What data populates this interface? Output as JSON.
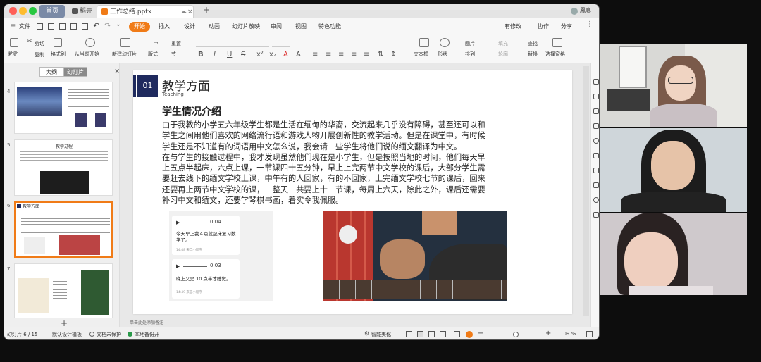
{
  "titlebar": {
    "tabs": [
      "首页",
      "稻壳",
      "工作总结.pptx"
    ],
    "user": "鳳息"
  },
  "menu": {
    "file": "文件",
    "items": [
      "开始",
      "插入",
      "设计",
      "动画",
      "幻灯片放映",
      "审阅",
      "视图",
      "特色功能"
    ],
    "right": [
      "有修改",
      "协作",
      "分享"
    ]
  },
  "ribbon": {
    "paste": "粘贴",
    "cut": "剪切",
    "copy": "复制",
    "format_painter": "格式刷",
    "from_current": "从当前开始",
    "new_slide": "新建幻灯片",
    "layout": "版式",
    "section": "节",
    "reset": "重置",
    "textbox": "文本框",
    "shape": "形状",
    "picture": "图片",
    "arrange": "排列",
    "fill": "填充",
    "outline": "轮廓",
    "find": "查找",
    "replace": "替换",
    "select_pane": "选择窗格"
  },
  "left_panel": {
    "tab_outline": "大纲",
    "tab_slides": "幻灯片",
    "slide_numbers": [
      "4",
      "5",
      "6",
      "7"
    ],
    "thumb5_title": "教学过程",
    "thumb6_title": "教学方面"
  },
  "slide": {
    "number": "01",
    "title": "教学方面",
    "subtitle": "Teaching",
    "heading": "学生情况介绍",
    "body": [
      "由于我教的小学五六年级学生都是生活在缅甸的华裔，交流起来几乎没有障碍，甚至还可以和",
      "学生之间用他们喜欢的网络流行语和游戏人物开展创新性的教学活动。但是在课堂中，有时候",
      "学生还是不知道有的词语用中文怎么说，我会请一些学生将他们说的缅文翻译为中文。",
      "在与学生的接触过程中，我才发现虽然他们现在是小学生，但是按照当地的时间，他们每天早",
      "上五点半起床，六点上课，一节课四十五分钟，早上上完两节中文学校的课后，大部分学生需",
      "要赶去线下的缅文学校上课，中午有的人回家，有的不回家，上完缅文学校七节的课后，回来",
      "还要再上两节中文学校的课，一整天一共要上十一节课，每周上六天，除此之外，课后还需要",
      "补习中文和缅文，还要学琴棋书画，着实令我佩服。"
    ],
    "audio": [
      {
        "time": "0:04",
        "text": "今天早上我４点就起床复习数学了。",
        "meta": "14:48 来自小程序"
      },
      {
        "time": "0:03",
        "text": "晚上又是 10 点半才睡觉。",
        "meta": "14:49 来自小程序"
      }
    ]
  },
  "notes_placeholder": "单击此处添加备注",
  "status": {
    "slide_pos": "幻灯片 6 / 15",
    "template": "默认设计模板",
    "protect": "文档未保护",
    "backup": "本地备份开",
    "beautify": "智能美化",
    "zoom": "109 %"
  },
  "colors": {
    "accent": "#f07b17",
    "slide_navy": "#1f2a5e"
  }
}
